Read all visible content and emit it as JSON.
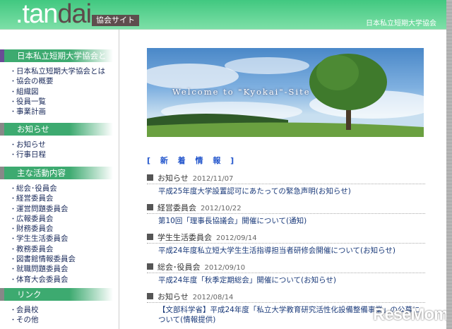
{
  "header": {
    "logo_prefix": ".tan",
    "logo_suffix": "dai",
    "logo_last": "ai",
    "site_label": "協会サイト",
    "org_name": "日本私立短期大学協会"
  },
  "sidebar": {
    "sections": [
      {
        "title": "日本私立短期大学協会とは",
        "items": [
          "日本私立短期大学協会とは",
          "協会の概要",
          "組織図",
          "役員一覧",
          "事業計画"
        ]
      },
      {
        "title": "お知らせ",
        "items": [
          "お知らせ",
          "行事日程"
        ]
      },
      {
        "title": "主な活動内容",
        "items": [
          "総会･役員会",
          "経営委員会",
          "運営問題委員会",
          "広報委員会",
          "財務委員会",
          "学生生活委員会",
          "教務委員会",
          "図書館情報委員会",
          "就職問題委員会",
          "体育大会委員会"
        ]
      },
      {
        "title": "リンク",
        "items": [
          "会員校",
          "その他"
        ]
      }
    ]
  },
  "banner": {
    "text": "Welcome to \"Kyokai\"-Site"
  },
  "news": {
    "title": "[ 新 着 情 報 ]",
    "items": [
      {
        "category": "お知らせ",
        "date": "2012/11/07",
        "link": "平成25年度大学設置認可にあたっての緊急声明(お知らせ)"
      },
      {
        "category": "経営委員会",
        "date": "2012/10/22",
        "link": "第10回「理事長協議会」開催について(通知)"
      },
      {
        "category": "学生生活委員会",
        "date": "2012/09/14",
        "link": "平成24年度私立短大学生生活指導担当者研修会開催について(お知らせ)"
      },
      {
        "category": "総会･役員会",
        "date": "2012/09/10",
        "link": "平成24年度「秋季定期総会」開催について(お知らせ)"
      },
      {
        "category": "お知らせ",
        "date": "2012/08/14",
        "link": "【文部科学省】平成24年度「私立大学教育研究活性化設備整備事業」の公募について(情報提供)"
      }
    ]
  },
  "watermark": "ReseMom"
}
